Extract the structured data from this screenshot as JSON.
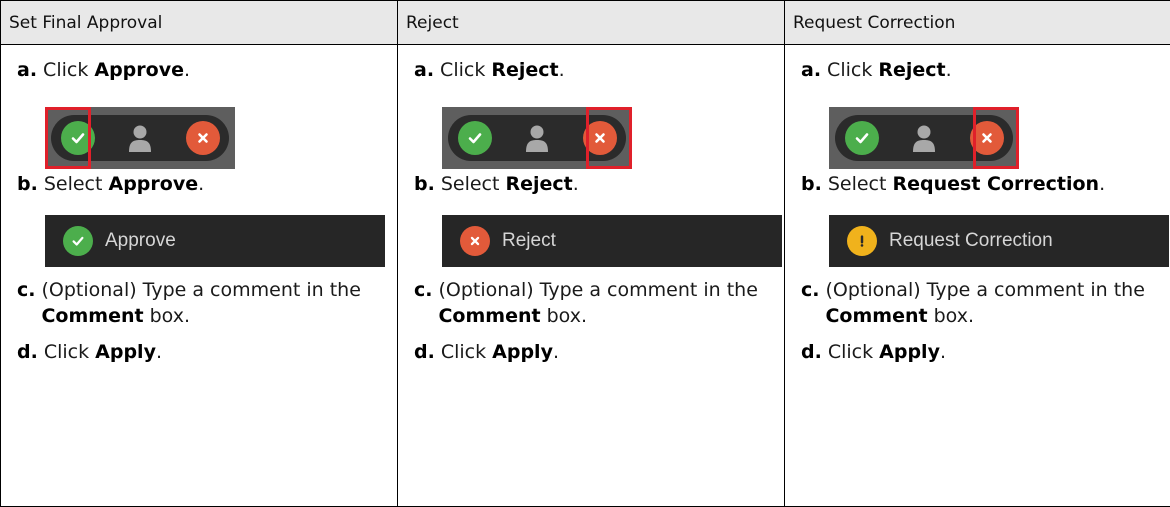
{
  "columns": [
    {
      "header": "Set Final Approval",
      "highlight": "approve",
      "step_a": {
        "letter": "a.",
        "prefix": "Click ",
        "bold": "Approve",
        "suffix": "."
      },
      "step_b": {
        "letter": "b.",
        "prefix": "Select ",
        "bold": "Approve",
        "suffix": "."
      },
      "option": {
        "icon": "check-icon",
        "label": "Approve"
      },
      "step_c": {
        "letter": "c.",
        "prefix": "(Optional) Type a comment in the ",
        "bold": "Comment",
        "suffix": " box."
      },
      "step_d": {
        "letter": "d.",
        "prefix": "Click ",
        "bold": "Apply",
        "suffix": "."
      }
    },
    {
      "header": "Reject",
      "highlight": "reject",
      "step_a": {
        "letter": "a.",
        "prefix": "Click ",
        "bold": "Reject",
        "suffix": "."
      },
      "step_b": {
        "letter": "b.",
        "prefix": "Select ",
        "bold": "Reject",
        "suffix": "."
      },
      "option": {
        "icon": "x-icon",
        "label": "Reject"
      },
      "step_c": {
        "letter": "c.",
        "prefix": "(Optional) Type a comment in the ",
        "bold": "Comment",
        "suffix": " box."
      },
      "step_d": {
        "letter": "d.",
        "prefix": "Click ",
        "bold": "Apply",
        "suffix": "."
      }
    },
    {
      "header": "Request Correction",
      "highlight": "reject",
      "step_a": {
        "letter": "a.",
        "prefix": "Click ",
        "bold": "Reject",
        "suffix": "."
      },
      "step_b": {
        "letter": "b.",
        "prefix": "Select ",
        "bold": "Request Correction",
        "suffix": "."
      },
      "option": {
        "icon": "exclamation-icon",
        "label": "Request Correction"
      },
      "step_c": {
        "letter": "c.",
        "prefix": "(Optional) Type a comment in the ",
        "bold": "Comment",
        "suffix": " box."
      },
      "step_d": {
        "letter": "d.",
        "prefix": "Click ",
        "bold": "Apply",
        "suffix": "."
      }
    }
  ],
  "colors": {
    "approve_green": "#4cae4c",
    "reject_red": "#e25a3a",
    "warning_yellow": "#f0b21c",
    "highlight_red": "#e0202a",
    "toolbar_dark": "#2b2b2b"
  }
}
